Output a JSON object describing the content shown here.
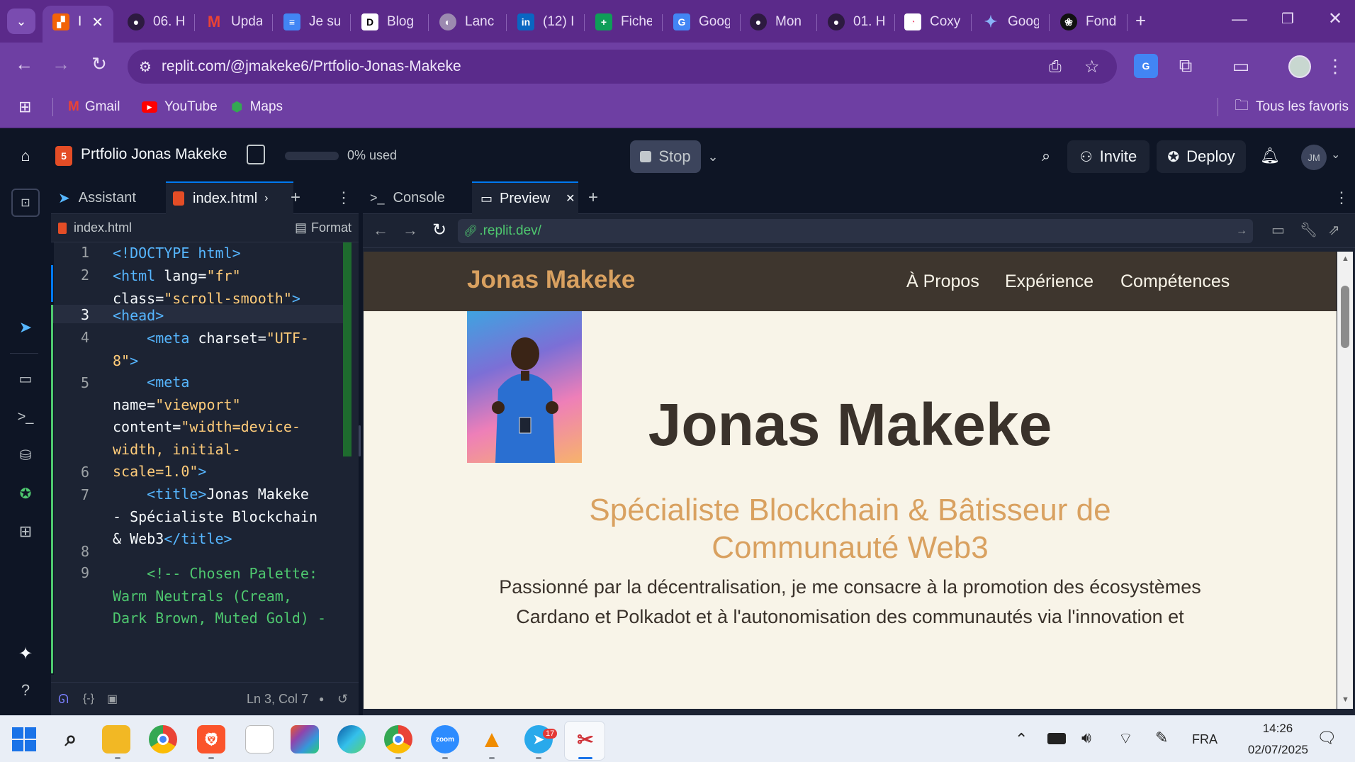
{
  "browser": {
    "tabs": [
      {
        "label": "I",
        "icon": "replit-icon",
        "active": true
      },
      {
        "label": "06. H",
        "icon": "github-icon"
      },
      {
        "label": "Upda",
        "icon": "gmail-icon"
      },
      {
        "label": "Je su",
        "icon": "docs-icon"
      },
      {
        "label": "Blog",
        "icon": "blog-icon"
      },
      {
        "label": "Lanc",
        "icon": "globe-icon"
      },
      {
        "label": "(12) I",
        "icon": "linkedin-icon"
      },
      {
        "label": "Fiche",
        "icon": "sheets-icon"
      },
      {
        "label": "Goog",
        "icon": "translate-icon"
      },
      {
        "label": "Mon",
        "icon": "github-icon"
      },
      {
        "label": "01. H",
        "icon": "github-icon"
      },
      {
        "label": "Coxy",
        "icon": "page-icon"
      },
      {
        "label": "Goog",
        "icon": "gemini-icon"
      },
      {
        "label": "Fond",
        "icon": "openai-icon"
      }
    ],
    "url": "replit.com/@jmakeke6/Prtfolio-Jonas-Makeke",
    "bookmarks": [
      {
        "label": "Gmail",
        "icon": "gmail-icon"
      },
      {
        "label": "YouTube",
        "icon": "youtube-icon"
      },
      {
        "label": "Maps",
        "icon": "maps-icon"
      }
    ],
    "all_bookmarks_label": "Tous les favoris"
  },
  "replit": {
    "project_title": "Prtfolio Jonas Makeke",
    "usage": "0% used",
    "usage_fraction": 0,
    "stop_label": "Stop",
    "invite_label": "Invite",
    "deploy_label": "Deploy",
    "avatar_initials": "JM",
    "editor": {
      "tab_assistant": "Assistant",
      "tab_file": "index.html",
      "file_path": "index.html",
      "format_label": "Format",
      "cursor": "Ln 3, Col 7",
      "line_numbers": [
        "1",
        "2",
        "3",
        "4",
        "5",
        "6",
        "7",
        "8",
        "9"
      ]
    },
    "preview": {
      "tab_console": "Console",
      "tab_preview": "Preview",
      "url": ".replit.dev/"
    }
  },
  "site": {
    "brand": "Jonas Makeke",
    "nav": [
      "À Propos",
      "Expérience",
      "Compétences"
    ],
    "name": "Jonas Makeke",
    "subtitle": "Spécialiste Blockchain & Bâtisseur de Communauté Web3",
    "intro_1": "Passionné par la décentralisation, je me consacre à la promotion des écosystèmes",
    "intro_2": "Cardano et Polkadot et à l'autonomisation des communautés via l'innovation et"
  },
  "taskbar": {
    "lang": "FRA",
    "time": "14:26",
    "date": "02/07/2025",
    "telegram_badge": "17"
  },
  "colors": {
    "chrome_purple": "#6e3fa3",
    "replit_bg": "#0e1525",
    "site_nav": "#3e362e",
    "site_gold": "#d9a160",
    "site_cream": "#f8f4e8"
  }
}
